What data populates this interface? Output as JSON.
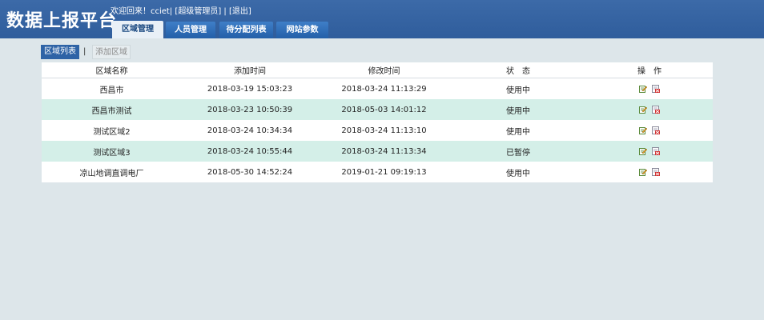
{
  "header": {
    "app_title": "数据上报平台",
    "welcome_text": "欢迎回来！cciet",
    "sep1": "|",
    "role_text": "[超级管理员]",
    "sep2": "|",
    "logout_text": "[退出]"
  },
  "nav": {
    "tabs": [
      {
        "label": "区域管理"
      },
      {
        "label": "人员管理"
      },
      {
        "label": "待分配列表"
      },
      {
        "label": "网站参数"
      }
    ]
  },
  "subtabs": {
    "list_label": "区域列表",
    "separator": "|",
    "add_label": "添加区域"
  },
  "table": {
    "headers": {
      "name": "区域名称",
      "added": "添加时间",
      "modified": "修改时间",
      "status": "状　态",
      "actions": "操　作"
    },
    "rows": [
      {
        "name": "西昌市",
        "added": "2018-03-19 15:03:23",
        "modified": "2018-03-24 11:13:29",
        "status": "使用中"
      },
      {
        "name": "西昌市测试",
        "added": "2018-03-23 10:50:39",
        "modified": "2018-05-03 14:01:12",
        "status": "使用中"
      },
      {
        "name": "测试区域2",
        "added": "2018-03-24 10:34:34",
        "modified": "2018-03-24 11:13:10",
        "status": "使用中"
      },
      {
        "name": "测试区域3",
        "added": "2018-03-24 10:55:44",
        "modified": "2018-03-24 11:13:34",
        "status": "已暂停"
      },
      {
        "name": "凉山地调直调电厂",
        "added": "2018-05-30 14:52:24",
        "modified": "2019-01-21 09:19:13",
        "status": "使用中"
      }
    ]
  },
  "icons": {
    "edit": "edit-icon",
    "delete": "delete-icon"
  },
  "colors": {
    "header_bg": "#2f5d9c",
    "active_tab_bg": "#e9f0f7",
    "row_alt_bg": "#d4efe8",
    "page_bg": "#dde6ea"
  }
}
